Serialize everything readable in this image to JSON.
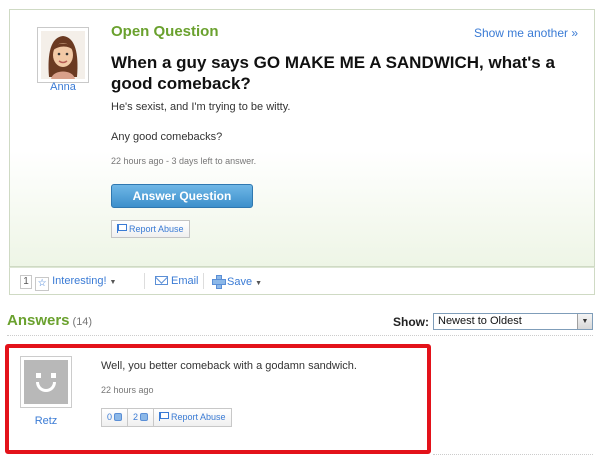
{
  "question": {
    "status_label": "Open Question",
    "show_another": "Show me another »",
    "asker_name": "Anna",
    "title": "When a guy says GO MAKE ME A SANDWICH, what's a good comeback?",
    "body_line1": "He's sexist, and I'm trying to be witty.",
    "body_line2": "Any good comebacks?",
    "meta": "22 hours ago - 3 days left to answer.",
    "answer_button": "Answer Question",
    "report_button": "Report Abuse"
  },
  "action_bar": {
    "interesting_count": "1",
    "interesting_label": "Interesting!",
    "email_label": "Email",
    "save_label": "Save"
  },
  "answers": {
    "title": "Answers",
    "count": "(14)",
    "show_label": "Show:",
    "sort_selected": "Newest to Oldest",
    "items": [
      {
        "author": "Retz",
        "text": "Well, you better comeback with a godamn sandwich.",
        "meta": "22 hours ago",
        "thumbs_up": "0",
        "thumbs_down": "2",
        "report_label": "Report Abuse"
      }
    ]
  },
  "colors": {
    "accent_green": "#6aa12e",
    "link_blue": "#3a7bd5",
    "highlight_red": "#e3121a"
  },
  "icons": [
    "anna-avatar",
    "star-icon",
    "mail-icon",
    "plus-icon",
    "flag-icon",
    "smiley-avatar-icon",
    "thumbs-up-icon",
    "thumbs-down-icon"
  ]
}
